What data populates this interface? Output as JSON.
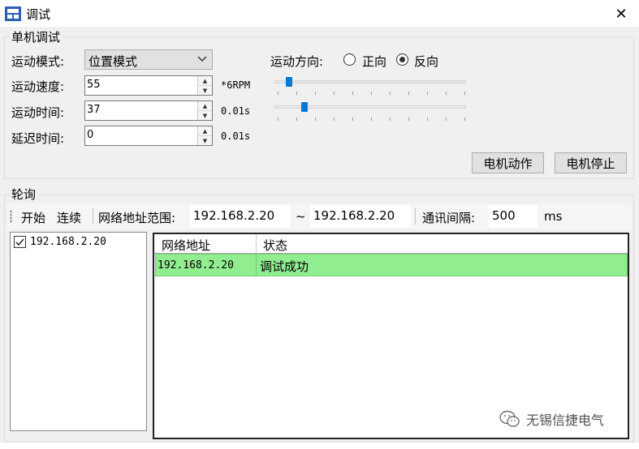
{
  "window": {
    "title": "调试",
    "close_glyph": "✕"
  },
  "single": {
    "group_title": "单机调试",
    "mode_label": "运动模式:",
    "mode_value": "位置模式",
    "speed_label": "运动速度:",
    "speed_value": "55",
    "speed_unit": "*6RPM",
    "time_label": "运动时间:",
    "time_value": "37",
    "time_unit": "0.01s",
    "delay_label": "延迟时间:",
    "delay_value": "0",
    "delay_unit": "0.01s",
    "direction_label": "运动方向:",
    "forward_label": "正向",
    "reverse_label": "反向",
    "direction_selected": "reverse",
    "start_motor_button": "电机动作",
    "stop_motor_button": "电机停止"
  },
  "poll": {
    "group_title": "轮询",
    "start_button": "开始",
    "continuous_button": "连续",
    "range_label": "网络地址范围:",
    "range_start": "192.168.2.20",
    "range_sep": "~",
    "range_end": "192.168.2.20",
    "interval_label": "通讯间隔:",
    "interval_value": "500",
    "interval_unit": "ms",
    "device_list": [
      {
        "label": "192.168.2.20",
        "checked": true
      }
    ],
    "table_headers": [
      "网络地址",
      "状态"
    ],
    "table_rows": [
      {
        "address": "192.168.2.20",
        "status": "调试成功"
      }
    ]
  },
  "watermark": {
    "text": "无锡信捷电气"
  },
  "colors": {
    "accent": "#0078d7",
    "success_row": "#90ee90"
  },
  "icons": {
    "app": "app-icon",
    "close": "close-icon",
    "dropdown": "chevron-down-icon"
  }
}
